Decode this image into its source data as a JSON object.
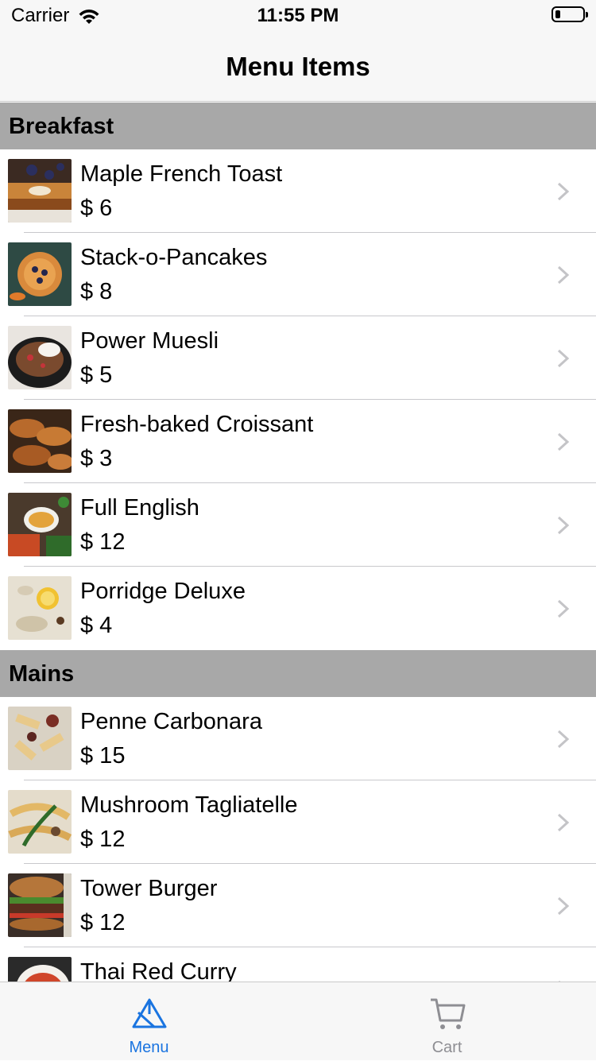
{
  "status_bar": {
    "carrier": "Carrier",
    "time": "11:55 PM"
  },
  "nav": {
    "title": "Menu Items"
  },
  "sections": [
    {
      "title": "Breakfast",
      "items": [
        {
          "name": "Maple French Toast",
          "price": "$ 6"
        },
        {
          "name": "Stack-o-Pancakes",
          "price": "$ 8"
        },
        {
          "name": "Power Muesli",
          "price": "$ 5"
        },
        {
          "name": "Fresh-baked Croissant",
          "price": "$ 3"
        },
        {
          "name": "Full English",
          "price": "$ 12"
        },
        {
          "name": "Porridge Deluxe",
          "price": "$ 4"
        }
      ]
    },
    {
      "title": "Mains",
      "items": [
        {
          "name": "Penne Carbonara",
          "price": "$ 15"
        },
        {
          "name": "Mushroom Tagliatelle",
          "price": "$ 12"
        },
        {
          "name": "Tower Burger",
          "price": "$ 12"
        },
        {
          "name": "Thai Red Curry",
          "price": ""
        }
      ]
    }
  ],
  "tabs": [
    {
      "label": "Menu",
      "icon": "menu-pyramid-icon",
      "active": true
    },
    {
      "label": "Cart",
      "icon": "cart-icon",
      "active": false
    }
  ],
  "colors": {
    "accent": "#1a74e0",
    "inactive": "#8e8e93",
    "section_header": "#a8a8a8"
  }
}
